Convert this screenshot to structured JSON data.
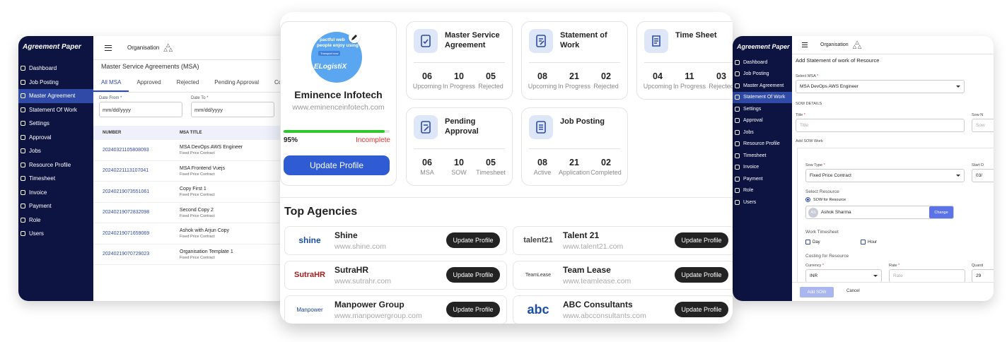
{
  "left_app": {
    "logo": "Agreement Paper",
    "org_label": "Organisation",
    "nav": [
      "Dashboard",
      "Job Posting",
      "Master Agreement",
      "Statement Of Work",
      "Settings",
      "Approval",
      "Jobs",
      "Resource Profile",
      "Timesheet",
      "Invoice",
      "Payment",
      "Role",
      "Users"
    ],
    "active_nav": "Master Agreement",
    "page_title": "Master Service Agreements (MSA)",
    "tabs": [
      "All MSA",
      "Approved",
      "Rejected",
      "Pending Approval",
      "Co"
    ],
    "date_from_label": "Date From *",
    "date_from_value": "mm/dd/yyyy",
    "date_to_label": "Date To *",
    "date_to_value": "mm/dd/yyyy",
    "columns": [
      "NUMBER",
      "MSA TITLE"
    ],
    "rows": [
      {
        "number": "20240321105808093",
        "title": "MSA DevOps AWS Engineer",
        "type": "Fixed Price Contract"
      },
      {
        "number": "20240221113107041",
        "title": "MSA Frontend Vuejs",
        "type": "Fixed Price Contract"
      },
      {
        "number": "20240219073551061",
        "title": "Copy First 1",
        "type": "Fixed Price Contract"
      },
      {
        "number": "20240219072832098",
        "title": "Second Copy 2",
        "type": "Fixed Price Contract"
      },
      {
        "number": "20240219071659069",
        "title": "Ashok with Arjun Copy",
        "type": "Fixed Price Contract"
      },
      {
        "number": "20240219070729023",
        "title": "Organisation Template 1",
        "type": "Fixed Price Contract"
      }
    ]
  },
  "center": {
    "profile": {
      "logo_text": "ELogistiX",
      "logo_line1": "pactful web",
      "logo_line2": "people enjoy using",
      "logo_button": "Transport now",
      "name": "Eminence Infotech",
      "website": "www.eminenceinfotech.com",
      "progress_label": "95%",
      "progress_value": 0.95,
      "status": "Incomplete",
      "button": "Update Profile"
    },
    "kpis": [
      {
        "title": "Master Service Agreement",
        "icon": "agreement-icon",
        "stats": [
          {
            "v": "06",
            "l": "Upcoming"
          },
          {
            "v": "10",
            "l": "In Progress"
          },
          {
            "v": "05",
            "l": "Rejected"
          }
        ]
      },
      {
        "title": "Statement of Work",
        "icon": "statement-icon",
        "stats": [
          {
            "v": "08",
            "l": "Upcoming"
          },
          {
            "v": "21",
            "l": "In Progress"
          },
          {
            "v": "02",
            "l": "Rejected"
          }
        ]
      },
      {
        "title": "Time Sheet",
        "icon": "timesheet-icon",
        "stats": [
          {
            "v": "04",
            "l": "Upcoming"
          },
          {
            "v": "11",
            "l": "In Progress"
          },
          {
            "v": "03",
            "l": "Rejected"
          }
        ]
      },
      {
        "title": "Pending Approval",
        "icon": "pending-approval-icon",
        "stats": [
          {
            "v": "06",
            "l": "MSA"
          },
          {
            "v": "10",
            "l": "SOW"
          },
          {
            "v": "05",
            "l": "Timesheet"
          }
        ]
      },
      {
        "title": "Job Posting",
        "icon": "job-posting-icon",
        "stats": [
          {
            "v": "08",
            "l": "Active"
          },
          {
            "v": "21",
            "l": "Application"
          },
          {
            "v": "02",
            "l": "Completed"
          }
        ]
      }
    ],
    "agencies_title": "Top Agencies",
    "agencies": [
      {
        "name": "Shine",
        "url": "www.shine.com",
        "logo": "shine",
        "button": "Update Profile"
      },
      {
        "name": "Talent 21",
        "url": "www.talent21.com",
        "logo": "talent21",
        "button": "Update Profile"
      },
      {
        "name": "SutraHR",
        "url": "www.sutrahr.com",
        "logo": "SutraHR",
        "button": "Update Profile"
      },
      {
        "name": "Team Lease",
        "url": "www.teamlease.com",
        "logo": "TeamLease",
        "button": "Update Profile"
      },
      {
        "name": "Manpower Group",
        "url": "www.manpowergroup.com",
        "logo": "Manpower",
        "button": "Update Profile"
      },
      {
        "name": "ABC Consultants",
        "url": "www.abcconsultants.com",
        "logo": "abc",
        "button": "Update Profile"
      }
    ]
  },
  "right_app": {
    "logo": "Agreement Paper",
    "org_label": "Organisation",
    "nav": [
      "Dashboard",
      "Job Posting",
      "Master Agreement",
      "Statement Of Work",
      "Settings",
      "Approval",
      "Jobs",
      "Resource Profile",
      "Timesheet",
      "Invoice",
      "Payment",
      "Role",
      "Users"
    ],
    "active_nav": "Statement Of Work",
    "page_title": "Add Statement of work of Resource",
    "select_msa_label": "Select MSA",
    "select_msa_value": "MSA DevOps AWS Engineer",
    "sow_details": "SOW DETAILS",
    "title_label": "Title",
    "title_placeholder": "Title",
    "sow_n_label": "Sow N",
    "sow_n_placeholder": "Sow",
    "add_sow_work": "Add SOW Work",
    "sow_type_label": "Sow Type",
    "sow_type_value": "Fixed Price Contract",
    "start_label": "Start D",
    "start_value": "03/",
    "select_resource": "Select Resource",
    "radio_label": "SOW for Resource",
    "resource_initials": "AS",
    "resource_name": "Ashok Sharma",
    "change_button": "Change",
    "work_timesheet": "Work Timesheet",
    "day": "Day",
    "hour": "Hour",
    "costing": "Costing for Resource",
    "currency_label": "Currency",
    "currency_value": "INR",
    "rate_label": "Rate",
    "rate_placeholder": "Rate",
    "quantity_label": "Quanti",
    "quantity_value": "29",
    "add_button": "Add SOW",
    "cancel_button": "Cancel"
  },
  "colors": {
    "sidebar": "#0d1442",
    "accent": "#2f4aa7",
    "progress": "#2ec82e",
    "incomplete": "#e03030",
    "primary_button": "#2f5bd3"
  }
}
